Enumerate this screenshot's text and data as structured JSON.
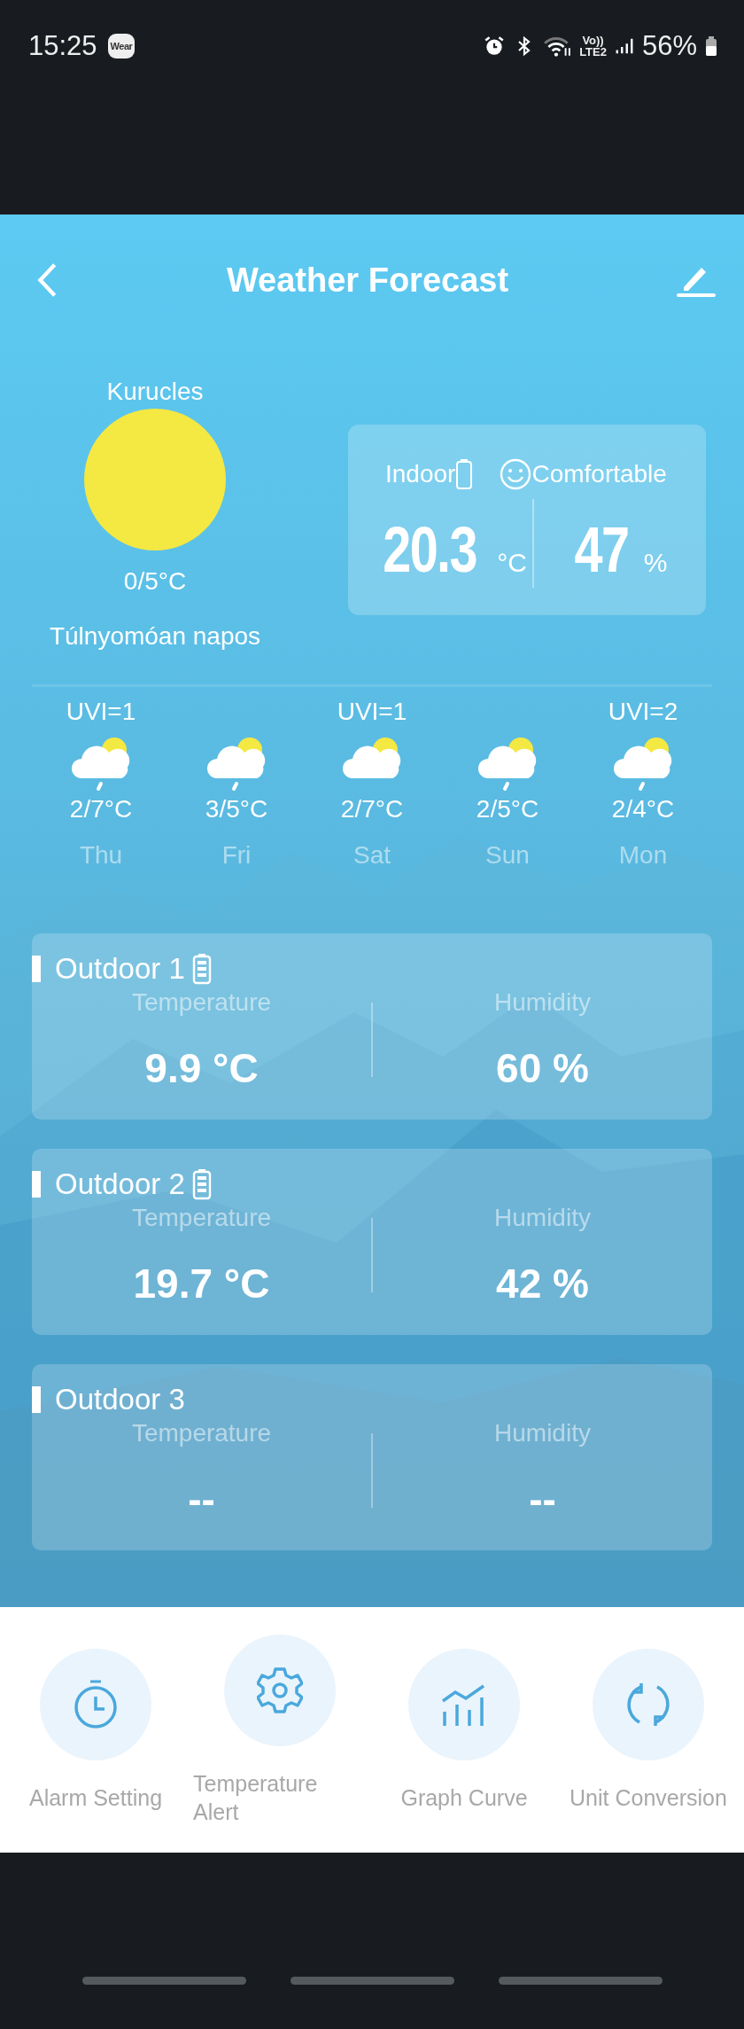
{
  "status_bar": {
    "time": "15:25",
    "badge": "Wear",
    "network_top": "Vo))",
    "network_bottom": "LTE2",
    "battery": "56%"
  },
  "header": {
    "title": "Weather Forecast"
  },
  "current": {
    "location": "Kurucles",
    "kind": "sunny",
    "range": "0/5°C",
    "condition": "Túlnyomóan napos"
  },
  "indoor": {
    "label": "Indoor",
    "comfort": "Comfortable",
    "temperature": "20.3",
    "temperature_unit": "°C",
    "humidity": "47",
    "humidity_unit": "%"
  },
  "forecast": [
    {
      "uvi": "UVI=1",
      "kind": "partly-cloudy-drizzle",
      "range": "2/7°C",
      "day": "Thu"
    },
    {
      "kind": "partly-cloudy-drizzle",
      "range": "3/5°C",
      "day": "Fri"
    },
    {
      "uvi": "UVI=1",
      "kind": "partly-cloudy",
      "range": "2/7°C",
      "day": "Sat"
    },
    {
      "kind": "partly-cloudy-drizzle",
      "range": "2/5°C",
      "day": "Sun"
    },
    {
      "uvi": "UVI=2",
      "kind": "partly-cloudy-drizzle",
      "range": "2/4°C",
      "day": "Mon"
    }
  ],
  "outdoor": [
    {
      "name": "Outdoor 1",
      "battery": true,
      "temperature_label": "Temperature",
      "temperature": "9.9 °C",
      "humidity_label": "Humidity",
      "humidity": "60 %"
    },
    {
      "name": "Outdoor 2",
      "battery": true,
      "temperature_label": "Temperature",
      "temperature": "19.7 °C",
      "humidity_label": "Humidity",
      "humidity": "42 %"
    },
    {
      "name": "Outdoor 3",
      "battery": false,
      "temperature_label": "Temperature",
      "temperature": "--",
      "humidity_label": "Humidity",
      "humidity": "--"
    }
  ],
  "actions": [
    {
      "label": "Alarm Setting",
      "kind": "timer"
    },
    {
      "label": "Temperature Alert",
      "kind": "gear"
    },
    {
      "label": "Graph Curve",
      "kind": "chart"
    },
    {
      "label": "Unit Conversion",
      "kind": "refresh"
    }
  ]
}
